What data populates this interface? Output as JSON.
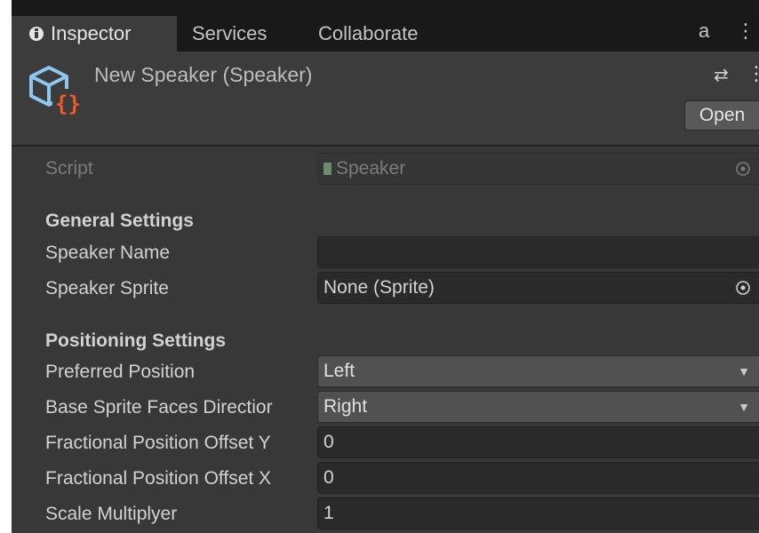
{
  "tabs": [
    {
      "label": "Inspector",
      "icon": "info-icon"
    },
    {
      "label": "Services"
    },
    {
      "label": "Collaborate"
    }
  ],
  "tab_actions": {
    "lock_icon": "a",
    "menu_icon": "⋮"
  },
  "header": {
    "title": "New Speaker (Speaker)",
    "open_button": "Open",
    "settings_icon": "⇄",
    "more_icon": "⋮"
  },
  "script": {
    "label": "Script",
    "value": "Speaker"
  },
  "general": {
    "heading": "General Settings",
    "speaker_name_label": "Speaker Name",
    "speaker_name_value": "",
    "speaker_sprite_label": "Speaker Sprite",
    "speaker_sprite_value": "None (Sprite)"
  },
  "positioning": {
    "heading": "Positioning Settings",
    "preferred_position_label": "Preferred Position",
    "preferred_position_value": "Left",
    "base_sprite_label": "Base Sprite Faces Directior",
    "base_sprite_value": "Right",
    "offset_y_label": "Fractional Position Offset Y",
    "offset_y_value": "0",
    "offset_x_label": "Fractional Position Offset X",
    "offset_x_value": "0",
    "scale_label": "Scale Multiplyer",
    "scale_value": "1"
  },
  "colors": {
    "panel_bg": "#383838",
    "tab_bar_bg": "#191919",
    "icon_blue": "#8ec8f0",
    "icon_orange": "#f05a28"
  }
}
